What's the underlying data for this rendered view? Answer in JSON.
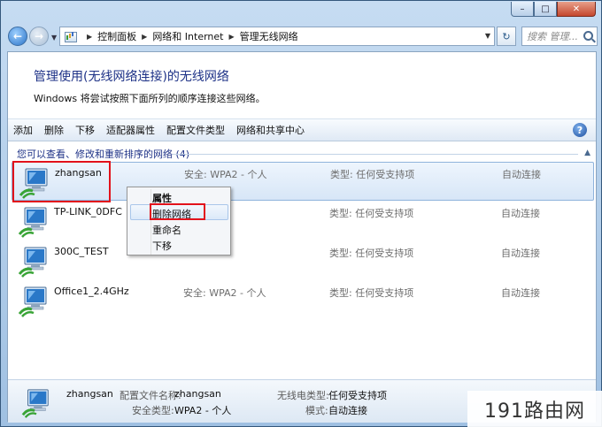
{
  "breadcrumb": [
    "控制面板",
    "网络和 Internet",
    "管理无线网络"
  ],
  "search": {
    "placeholder": "搜索 管理..."
  },
  "header": {
    "title": "管理使用(无线网络连接)的无线网络",
    "description": "Windows 将尝试按照下面所列的顺序连接这些网络。"
  },
  "toolbar": {
    "items": [
      "添加",
      "删除",
      "下移",
      "适配器属性",
      "配置文件类型",
      "网络和共享中心"
    ],
    "help": "?"
  },
  "group": {
    "label": "您可以查看、修改和重新排序的网络 (4)"
  },
  "networks": [
    {
      "name": "zhangsan",
      "security": "安全: WPA2 - 个人",
      "type": "类型: 任何受支持项",
      "mode": "自动连接"
    },
    {
      "name": "TP-LINK_0DFC",
      "security": "",
      "type": "类型: 任何受支持项",
      "mode": "自动连接"
    },
    {
      "name": "300C_TEST",
      "security": "",
      "type": "类型: 任何受支持项",
      "mode": "自动连接"
    },
    {
      "name": "Office1_2.4GHz",
      "security": "安全: WPA2 - 个人",
      "type": "类型: 任何受支持项",
      "mode": "自动连接"
    }
  ],
  "context_menu": {
    "items": [
      "属性",
      "删除网络",
      "重命名",
      "下移"
    ]
  },
  "details": {
    "name": "zhangsan",
    "profile_label": "配置文件名称:",
    "profile_value": "zhangsan",
    "security_label": "安全类型:",
    "security_value": "WPA2 - 个人",
    "radio_label": "无线电类型:",
    "radio_value": "任何受支持项",
    "mode_label": "模式:",
    "mode_value": "自动连接"
  },
  "watermark": "191路由网",
  "colors": {
    "title": "#1e3287",
    "highlight": "#e2121b",
    "selection": "#d7e6f7"
  }
}
